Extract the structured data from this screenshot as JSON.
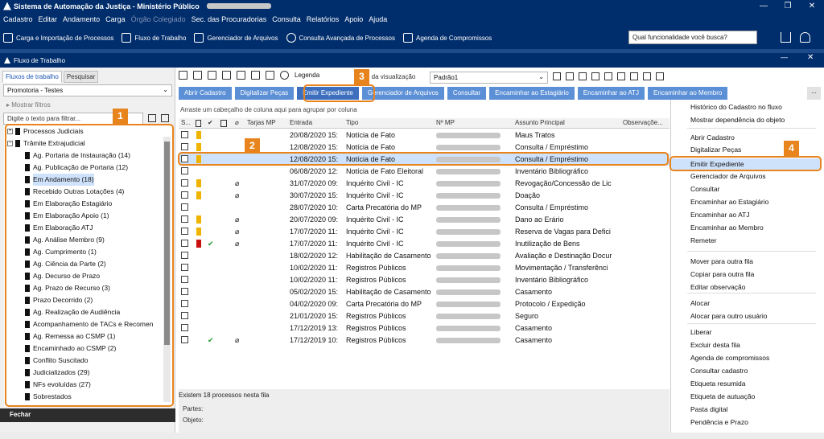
{
  "window": {
    "title": "Sistema de Automação da Justiça - Ministério Público",
    "minimize": "—",
    "maximize": "❐",
    "close": "✕"
  },
  "menu": [
    "Cadastro",
    "Editar",
    "Andamento",
    "Carga",
    "Órgão Colegiado",
    "Sec. das Procuradorias",
    "Consulta",
    "Relatórios",
    "Apoio",
    "Ajuda"
  ],
  "toolbar": {
    "items": [
      "Carga e Importação de Processos",
      "Fluxo de Trabalho",
      "Gerenciador de Arquivos",
      "Consulta Avançada de Processos",
      "Agenda de Compromissos"
    ],
    "search_placeholder": "Qual funcionalidade você busca?"
  },
  "panel": {
    "title": "Fluxo de Trabalho",
    "close": "✕",
    "minimize": "—"
  },
  "left": {
    "tabs": [
      "Fluxos de trabalho",
      "Pesquisar"
    ],
    "selected_flow": "Promotoria - Testes",
    "show_filters": "Mostrar filtros",
    "filter_placeholder": "Digite o texto para filtrar...",
    "close_label": "Fechar",
    "tree": [
      "Processos Judiciais",
      "Trâmite Extrajudicial",
      "Ag. Portaria de Instauração (14)",
      "Ag. Publicação de Portaria (12)",
      "Em Andamento (18)",
      "Recebido Outras Lotações (4)",
      "Em Elaboração Estagiário",
      "Em Elaboração Apoio (1)",
      "Em Elaboração ATJ",
      "Ag. Análise Membro (9)",
      "Ag. Cumprimento (1)",
      "Ag. Ciência da Parte (2)",
      "Ag. Decurso de Prazo",
      "Ag. Prazo de Recurso (3)",
      "Prazo Decorrido (2)",
      "Ag. Realização de Audiência",
      "Acompanhamento de TACs e Recomen",
      "Ag. Remessa ao CSMP (1)",
      "Encaminhado ao CSMP (2)",
      "Conflito Suscitado",
      "Judicializados (29)",
      "NFs evoluídas (27)",
      "Sobrestados"
    ]
  },
  "main": {
    "legend": "Legenda",
    "view_label": "o da visualização",
    "view_value": "Padrão1",
    "actions": [
      "Abrir Cadastro",
      "Digitalizar Peças",
      "Emitir Expediente",
      "Gerenciador de Arquivos",
      "Consultar",
      "Encaminhar ao Estagiário",
      "Encaminhar ao ATJ",
      "Encaminhar ao Membro"
    ],
    "more": "...",
    "drag_hint": "Arraste um cabeçalho de coluna aqui para agrupar por coluna",
    "columns": [
      "S...",
      "Tarjas MP",
      "Entrada",
      "Tipo",
      "Nº MP",
      "Assunto Principal",
      "Observaçõe..."
    ],
    "rows": [
      {
        "date": "20/08/2020 15:",
        "type": "Notícia de Fato",
        "subject": "Maus Tratos"
      },
      {
        "date": "12/08/2020 15:",
        "type": "Notícia de Fato",
        "subject": "Consulta / Empréstimo"
      },
      {
        "date": "12/08/2020 15:",
        "type": "Notícia de Fato",
        "subject": "Consulta / Empréstimo"
      },
      {
        "date": "06/08/2020 12:",
        "type": "Notícia de Fato Eleitoral",
        "subject": "Inventário Bibliográfico"
      },
      {
        "date": "31/07/2020 09:",
        "type": "Inquérito Civil - IC",
        "subject": "Revogação/Concessão de Lic"
      },
      {
        "date": "30/07/2020 15:",
        "type": "Inquérito Civil - IC",
        "subject": "Doação"
      },
      {
        "date": "28/07/2020 10:",
        "type": "Carta Precatória do MP",
        "subject": "Consulta / Empréstimo"
      },
      {
        "date": "20/07/2020 09:",
        "type": "Inquérito Civil - IC",
        "subject": "Dano ao Erário"
      },
      {
        "date": "17/07/2020 11:",
        "type": "Inquérito Civil - IC",
        "subject": "Reserva de Vagas para Defici"
      },
      {
        "date": "17/07/2020 11:",
        "type": "Inquérito Civil - IC",
        "subject": "Inutilização de Bens"
      },
      {
        "date": "18/02/2020 12:",
        "type": "Habilitação de Casamento",
        "subject": "Avaliação e Destinação Docur"
      },
      {
        "date": "10/02/2020 11:",
        "type": "Registros Públicos",
        "subject": "Movimentação / Transferênci"
      },
      {
        "date": "10/02/2020 11:",
        "type": "Registros Públicos",
        "subject": "Inventário Bibliográfico"
      },
      {
        "date": "05/02/2020 15:",
        "type": "Habilitação de Casamento",
        "subject": "Casamento"
      },
      {
        "date": "04/02/2020 09:",
        "type": "Carta Precatória do MP",
        "subject": "Protocolo / Expedição"
      },
      {
        "date": "21/01/2020 15:",
        "type": "Registros Públicos",
        "subject": "Seguro"
      },
      {
        "date": "17/12/2019 13:",
        "type": "Registros Públicos",
        "subject": "Casamento"
      },
      {
        "date": "17/12/2019 10:",
        "type": "Registros Públicos",
        "subject": "Casamento"
      }
    ],
    "status": "Existem 18 processos nesta fila",
    "parts_label": "Partes:",
    "object_label": "Objeto:"
  },
  "context_menu": [
    "Histórico do Cadastro no fluxo",
    "Mostrar dependência do objeto",
    "Abrir Cadastro",
    "Digitalizar Peças",
    "Emitir Expediente",
    "Gerenciador de Arquivos",
    "Consultar",
    "Encaminhar ao Estagiário",
    "Encaminhar ao ATJ",
    "Encaminhar ao Membro",
    "Remeter",
    "Mover para outra fila",
    "Copiar para outra fila",
    "Editar observação",
    "Alocar",
    "Alocar para outro usuário",
    "Liberar",
    "Excluir desta fila",
    "Agenda de compromissos",
    "Consultar cadastro",
    "Etiqueta resumida",
    "Etiqueta de autuação",
    "Pasta digital",
    "Pendência e Prazo"
  ],
  "badges": [
    "1",
    "2",
    "3",
    "4"
  ],
  "colors": {
    "accent": "#002d6b",
    "button": "#5b8fd6",
    "highlight": "#e8841e",
    "selection": "#cfe2fb"
  }
}
